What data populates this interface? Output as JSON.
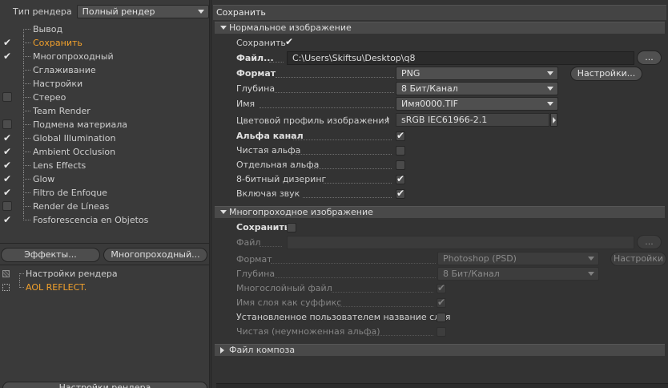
{
  "left": {
    "render_type_label": "Тип рендера",
    "render_type_value": "Полный рендер",
    "tree": [
      {
        "label": "Вывод",
        "check": "none",
        "selected": false
      },
      {
        "label": "Сохранить",
        "check": "tick",
        "selected": true
      },
      {
        "label": "Многопроходный",
        "check": "tick",
        "selected": false
      },
      {
        "label": "Сглаживание",
        "check": "none",
        "selected": false
      },
      {
        "label": "Настройки",
        "check": "none",
        "selected": false
      },
      {
        "label": "Стерео",
        "check": "box",
        "selected": false
      },
      {
        "label": "Team Render",
        "check": "none",
        "selected": false
      },
      {
        "label": "Подмена материала",
        "check": "box",
        "selected": false
      },
      {
        "label": "Global Illumination",
        "check": "tick",
        "selected": false
      },
      {
        "label": "Ambient Occlusion",
        "check": "tick",
        "selected": false
      },
      {
        "label": "Lens Effects",
        "check": "tick",
        "selected": false
      },
      {
        "label": "Glow",
        "check": "tick",
        "selected": false
      },
      {
        "label": "Filtro de Enfoque",
        "check": "tick",
        "selected": false
      },
      {
        "label": "Render de Líneas",
        "check": "box",
        "selected": false
      },
      {
        "label": "Fosforescencia en Objetos",
        "check": "tick",
        "selected": false
      }
    ],
    "effects_button": "Эффекты...",
    "multipass_button": "Многопроходный...",
    "settings_list": [
      {
        "label": "Настройки рендера",
        "selected": false
      },
      {
        "label": "AOL REFLECT.",
        "selected": true
      }
    ],
    "bottom_button": "Настройки рендера"
  },
  "right": {
    "title": "Сохранить",
    "normal_section": {
      "header": "Нормальное изображение",
      "save_label": "Сохранить",
      "save_checked": true,
      "file_label": "Файл...",
      "file_value": "C:\\Users\\Skiftsu\\Desktop\\q8",
      "browse_label": "...",
      "format_label": "Формат",
      "format_value": "PNG",
      "settings_button": "Настройки...",
      "depth_label": "Глубина",
      "depth_value": "8 Бит/Канал",
      "name_label": "Имя",
      "name_value": "Имя0000.TIF",
      "color_profile_label": "Цветовой профиль изображения",
      "color_profile_value": "sRGB IEC61966-2.1",
      "alpha_label": "Альфа канал",
      "alpha_checked": true,
      "straight_alpha_label": "Чистая альфа",
      "straight_alpha_checked": false,
      "separate_alpha_label": "Отдельная альфа",
      "separate_alpha_checked": false,
      "dither_label": "8-битный дизеринг",
      "dither_checked": true,
      "sound_label": "Включая звук",
      "sound_checked": true
    },
    "multipass_section": {
      "header": "Многопроходное изображение",
      "save_label": "Сохранить",
      "save_checked": false,
      "file_label": "Файл",
      "file_value": "",
      "browse_label": "...",
      "format_label": "Формат",
      "format_value": "Photoshop (PSD)",
      "settings_button": "Настройки",
      "depth_label": "Глубина",
      "depth_value": "8 Бит/Канал",
      "layer_file_label": "Многослойный файл",
      "layer_file_checked": true,
      "layer_suffix_label": "Имя слоя как суффикс",
      "layer_suffix_checked": true,
      "user_layer_name_label": "Установленное пользователем название слоя",
      "user_layer_name_checked": false,
      "straight_alpha_label": "Чистая (неумноженная альфа)",
      "straight_alpha_checked": false
    },
    "compose_section": {
      "header": "Файл композа"
    }
  }
}
